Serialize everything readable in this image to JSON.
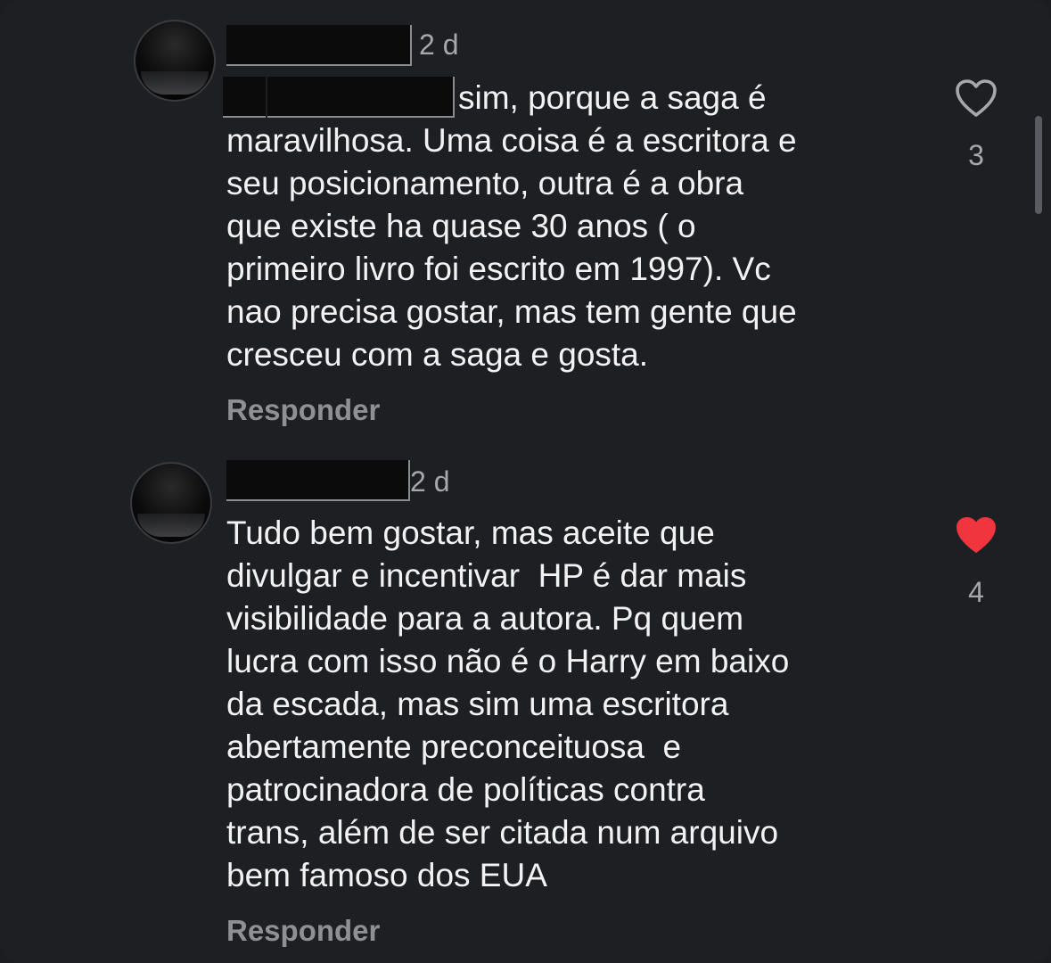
{
  "comments": [
    {
      "time": "2 d",
      "text": "sim, porque a saga é\nmaravilhosa. Uma coisa é a escritora e\nseu posicionamento, outra é a obra\nque existe ha quase 30 anos ( o\nprimeiro livro foi escrito em 1997). Vc\nnao precisa gostar, mas tem gente que\ncresceu com a saga e gosta.",
      "reply_label": "Responder",
      "like_count": "3",
      "liked": false,
      "like_icon": "heart-outline-icon"
    },
    {
      "time": "2 d",
      "text": "Tudo bem gostar, mas aceite que\ndivulgar e incentivar  HP é dar mais\nvisibilidade para a autora. Pq quem\nlucra com isso não é o Harry em baixo\nda escada, mas sim uma escritora\nabertamente preconceituosa  e\npatrocinadora de políticas contra\ntrans, além de ser citada num arquivo\nbem famoso dos EUA",
      "reply_label": "Responder",
      "like_count": "4",
      "liked": true,
      "like_icon": "heart-filled-icon"
    }
  ],
  "colors": {
    "background": "#1e1f23",
    "text": "#f2f2f4",
    "secondary_text": "#a7a8ac",
    "liked_heart": "#f0353f"
  }
}
